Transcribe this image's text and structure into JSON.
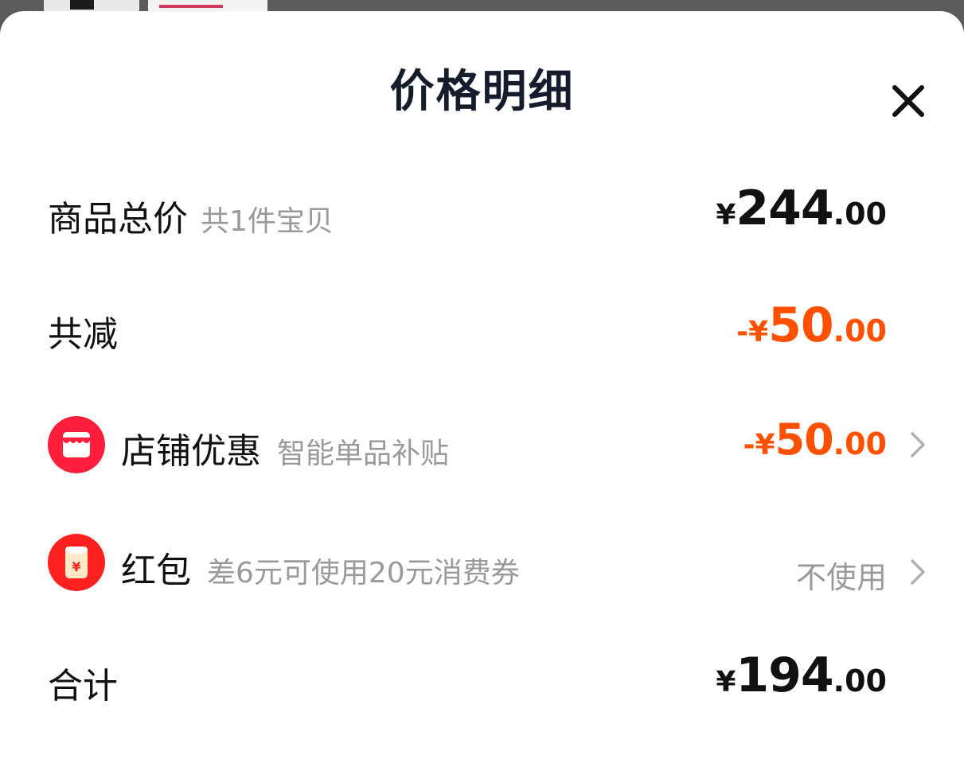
{
  "header": {
    "title": "价格明细",
    "close_icon": "close-icon"
  },
  "rows": {
    "goods_total": {
      "label": "商品总价",
      "sub": "共1件宝贝",
      "currency": "¥",
      "integer": "244",
      "decimal": ".00"
    },
    "total_discount": {
      "label": "共减",
      "prefix": "-¥",
      "integer": "50",
      "decimal": ".00",
      "color": "#ff5000"
    },
    "shop_discount": {
      "icon": "shop-icon",
      "label": "店铺优惠",
      "sub": "智能单品补贴",
      "prefix": "-¥",
      "integer": "50",
      "decimal": ".00",
      "color": "#ff5000"
    },
    "red_packet": {
      "icon": "red-packet-icon",
      "label": "红包",
      "sub": "差6元可使用20元消费券",
      "value": "不使用"
    },
    "sum": {
      "label": "合计",
      "currency": "¥",
      "integer": "194",
      "decimal": ".00"
    }
  },
  "colors": {
    "accent_red": "#ff1f3d",
    "discount_orange": "#ff5000",
    "muted": "#9a9a9a"
  }
}
